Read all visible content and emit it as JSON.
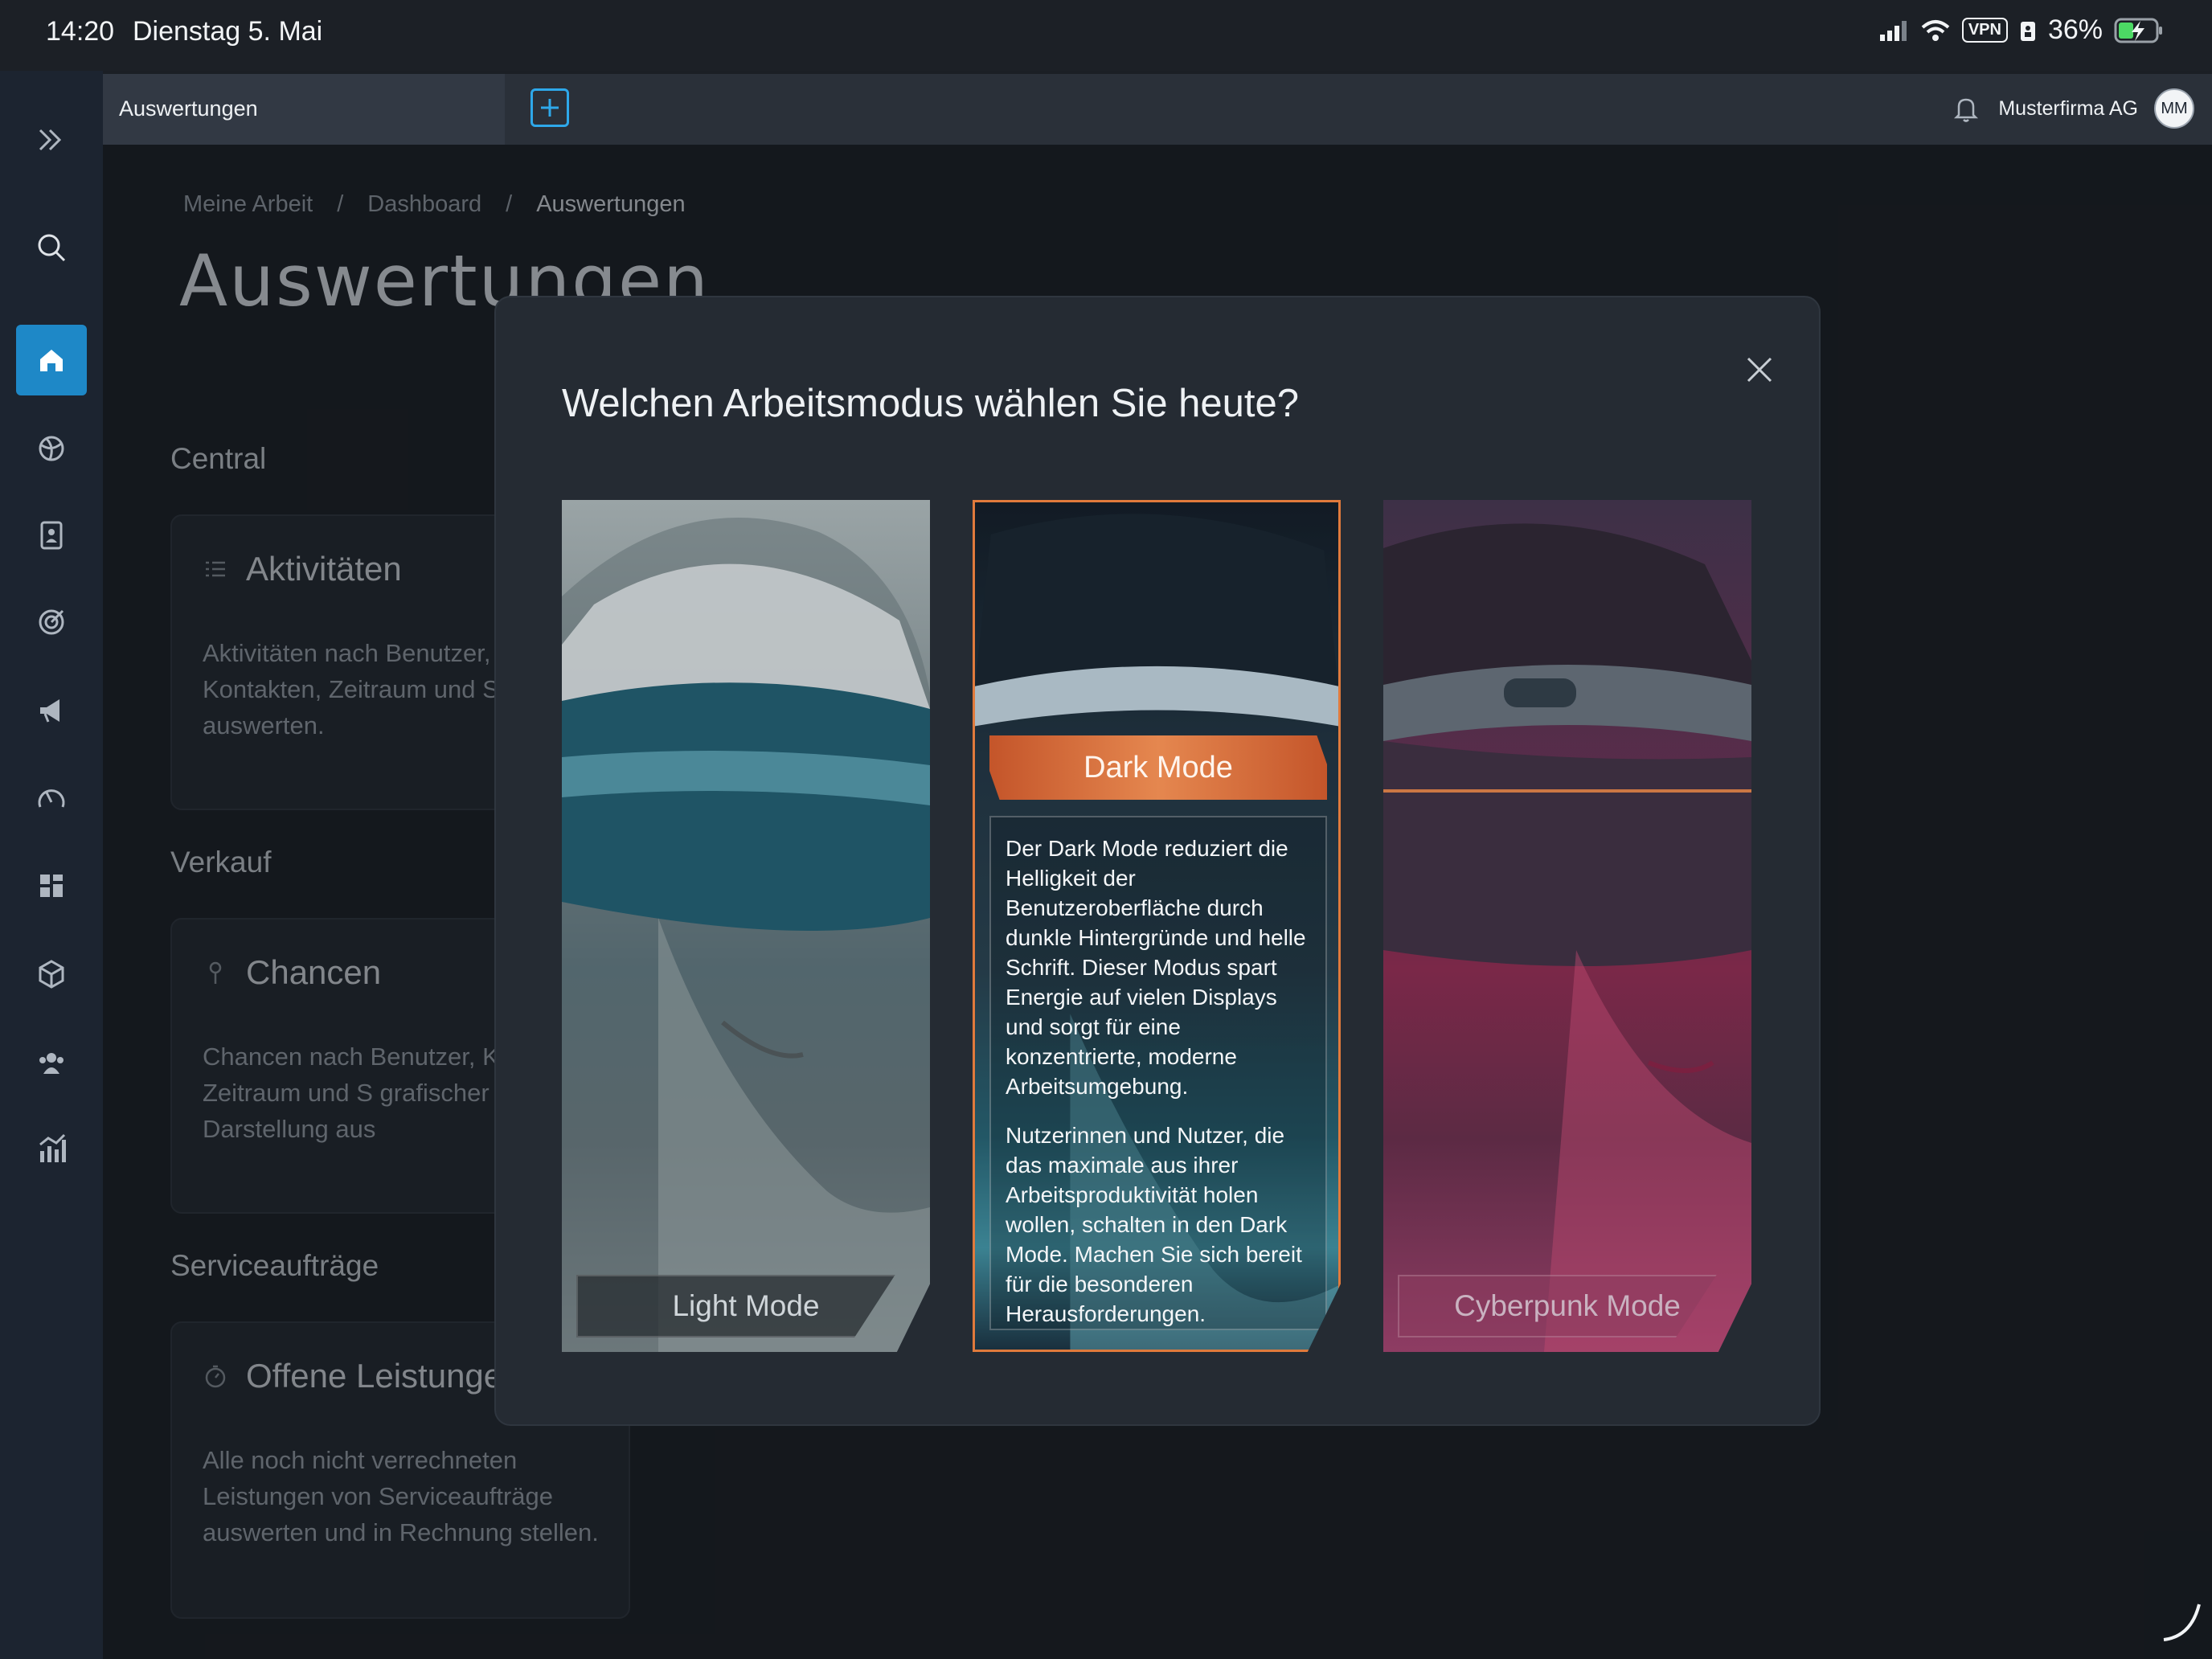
{
  "status_bar": {
    "time": "14:20",
    "date": "Dienstag 5. Mai",
    "vpn": "VPN",
    "battery": "36%"
  },
  "tab_bar": {
    "active_tab": "Auswertungen",
    "company": "Musterfirma AG",
    "avatar_initials": "MM"
  },
  "breadcrumb": [
    "Meine Arbeit",
    "/",
    "Dashboard",
    "/",
    "Auswertungen"
  ],
  "page_title": "Auswertungen",
  "sections": [
    {
      "heading": "Central",
      "card_title": "Aktivitäten",
      "card_text": "Aktivitäten nach Benutzer, Kontakten, Zeitraum und S auswerten."
    },
    {
      "heading": "Verkauf",
      "card_title": "Chancen",
      "card_text": "Chancen nach Benutzer, Kontakten, Zeitraum und S grafischer Darstellung aus"
    },
    {
      "heading": "Serviceaufträge",
      "card_title": "Offene Leistunge",
      "card_text": "Alle noch nicht verrechneten Leistungen von Serviceaufträge auswerten und in Rechnung stellen."
    }
  ],
  "modal": {
    "title": "Welchen Arbeitsmodus wählen Sie heute?",
    "modes": [
      {
        "label": "Light Mode"
      },
      {
        "label": "Dark Mode",
        "desc_1": "Der Dark Mode reduziert die Helligkeit der Benutzeroberfläche durch dunkle Hintergründe und helle Schrift. Dieser Modus spart Energie auf vielen Displays und sorgt für eine konzentrierte, moderne Arbeitsumgebung.",
        "desc_2": "Nutzerinnen und Nutzer, die das maximale aus ihrer Arbeitsproduktivität holen wollen, schalten in den Dark Mode. Machen Sie sich bereit für die besonderen Herausforderungen."
      },
      {
        "label": "Cyberpunk Mode"
      }
    ]
  },
  "colors": {
    "accent": "#1e88c7",
    "dark_mode_border": "#e07a3c",
    "background": "#1b1f25"
  },
  "nav_icons": [
    "expand-icon",
    "search-icon",
    "home-icon",
    "globe-icon",
    "contacts-icon",
    "target-icon",
    "megaphone-icon",
    "gauge-icon",
    "board-icon",
    "box-icon",
    "team-icon",
    "analytics-icon"
  ]
}
